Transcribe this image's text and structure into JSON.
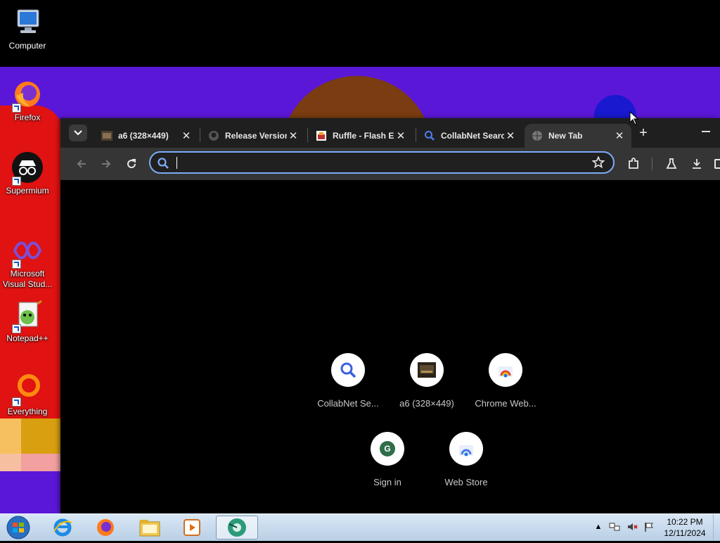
{
  "desktop": {
    "icons": [
      {
        "label": "Computer",
        "icon": "computer-icon"
      },
      {
        "label": "Firefox",
        "icon": "firefox-icon"
      },
      {
        "label": "Supermium",
        "icon": "supermium-icon"
      },
      {
        "label": "Microsoft Visual Stud...",
        "icon": "visual-studio-icon"
      },
      {
        "label": "Notepad++",
        "icon": "notepad-plus-plus-icon"
      },
      {
        "label": "Everything",
        "icon": "everything-icon"
      }
    ]
  },
  "browser": {
    "tabs": [
      {
        "title": "a6 (328×449)",
        "icon": "image-favicon",
        "active": false
      },
      {
        "title": "Release Versions",
        "icon": "github-favicon",
        "active": false
      },
      {
        "title": "Ruffle - Flash Emulator",
        "icon": "ruffle-favicon",
        "active": false
      },
      {
        "title": "CollabNet Search",
        "icon": "search-favicon",
        "active": false
      },
      {
        "title": "New Tab",
        "icon": "globe-favicon",
        "active": true
      }
    ],
    "omnibox": {
      "value": "",
      "placeholder": ""
    },
    "shortcuts": [
      {
        "label": "CollabNet Se...",
        "icon": "search-icon"
      },
      {
        "label": "a6 (328×449)",
        "icon": "image-thumbnail-icon"
      },
      {
        "label": "Chrome Web...",
        "icon": "chrome-web-store-icon"
      },
      {
        "label": "Sign in",
        "icon": "google-g-icon",
        "letter": "G"
      },
      {
        "label": "Web Store",
        "icon": "web-store-icon"
      }
    ]
  },
  "taskbar": {
    "apps": [
      {
        "name": "internet-explorer",
        "icon": "internet-explorer-icon"
      },
      {
        "name": "firefox",
        "icon": "firefox-icon"
      },
      {
        "name": "file-explorer",
        "icon": "folder-icon"
      },
      {
        "name": "media-player",
        "icon": "media-player-icon"
      },
      {
        "name": "supermium",
        "icon": "supermium-icon",
        "active": true
      }
    ],
    "clock": {
      "time": "10:22 PM",
      "date": "12/11/2024"
    }
  },
  "colors": {
    "accent": "#7cacf8",
    "tab_bg": "#1f1f1f",
    "toolbar_bg": "#353535",
    "desktop_purple": "#5b17d8"
  }
}
